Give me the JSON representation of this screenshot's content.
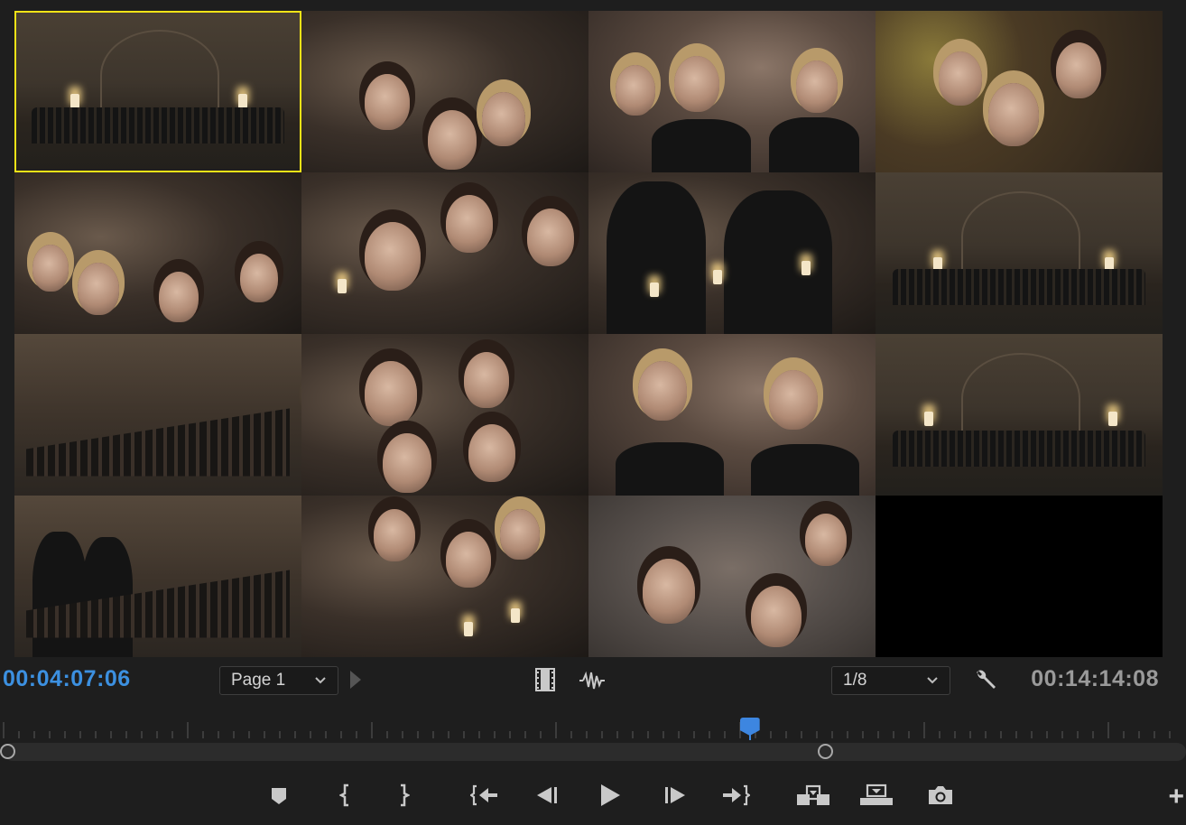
{
  "monitor": {
    "current_timecode": "00:04:07:06",
    "duration_timecode": "00:14:14:08",
    "page_select": {
      "value": "Page 1"
    },
    "angle_select": {
      "value": "1/8"
    },
    "selected_camera_index": 0,
    "playhead_position_fraction": 0.633,
    "in_point_fraction": 0.0,
    "out_point_fraction": 0.697
  },
  "cameras": [
    {
      "scene": "church-wide"
    },
    {
      "scene": "singers-closeup"
    },
    {
      "scene": "singers-closeup"
    },
    {
      "scene": "singers-closeup"
    },
    {
      "scene": "singers-closeup"
    },
    {
      "scene": "singers-closeup"
    },
    {
      "scene": "candles-closeup"
    },
    {
      "scene": "church-wide"
    },
    {
      "scene": "choir-side"
    },
    {
      "scene": "singers-closeup"
    },
    {
      "scene": "singers-closeup"
    },
    {
      "scene": "church-wide"
    },
    {
      "scene": "choir-side"
    },
    {
      "scene": "singers-closeup"
    },
    {
      "scene": "singers-closeup"
    },
    {
      "scene": "empty"
    }
  ],
  "icons": {
    "video_view": "film-strip-icon",
    "audio_view": "waveform-icon",
    "settings": "wrench-icon",
    "add_marker": "marker-icon",
    "mark_in": "mark-in-icon",
    "mark_out": "mark-out-icon",
    "go_to_in": "go-to-in-icon",
    "step_back": "step-back-icon",
    "play": "play-icon",
    "step_forward": "step-forward-icon",
    "go_to_out": "go-to-out-icon",
    "insert": "insert-icon",
    "overwrite": "overwrite-icon",
    "export_frame": "camera-icon",
    "button_editor": "plus-icon"
  },
  "colors": {
    "timecode_active": "#3c90e0",
    "timecode_inactive": "#9a9a9a",
    "selection_outline": "#f3e317",
    "playhead": "#3d86e0"
  }
}
